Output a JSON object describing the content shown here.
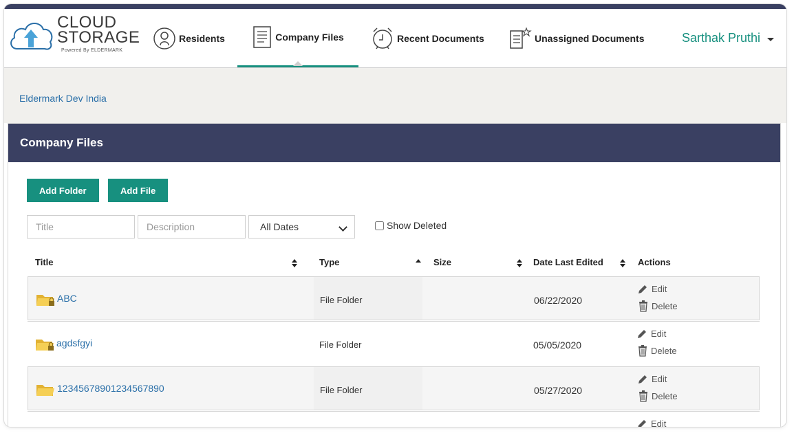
{
  "app": {
    "logo_line1": "CLOUD",
    "logo_line2": "STORAGE",
    "logo_powered": "Powered By ELDERMARK"
  },
  "nav": {
    "items": [
      {
        "label": "Residents",
        "icon": "person-circle-icon"
      },
      {
        "label": "Company Files",
        "icon": "document-lines-icon",
        "active": true
      },
      {
        "label": "Recent Documents",
        "icon": "alarm-clock-icon"
      },
      {
        "label": "Unassigned Documents",
        "icon": "document-star-icon"
      }
    ],
    "user_name": "Sarthak Pruthi"
  },
  "breadcrumb": "Eldermark Dev India",
  "panel": {
    "title": "Company Files",
    "add_folder_label": "Add Folder",
    "add_file_label": "Add File",
    "filters": {
      "title_placeholder": "Title",
      "description_placeholder": "Description",
      "date_value": "All Dates",
      "show_deleted_label": "Show Deleted"
    },
    "columns": {
      "title": "Title",
      "type": "Type",
      "size": "Size",
      "date": "Date Last Edited",
      "actions": "Actions"
    },
    "rows": [
      {
        "title": "ABC",
        "type": "File Folder",
        "size": "",
        "date": "06/22/2020",
        "locked": true
      },
      {
        "title": "agdsfgyi",
        "type": "File Folder",
        "size": "",
        "date": "05/05/2020",
        "locked": true
      },
      {
        "title": "12345678901234567890",
        "type": "File Folder",
        "size": "",
        "date": "05/27/2020",
        "locked": false
      },
      {
        "title": "",
        "type": "",
        "size": "",
        "date": "",
        "locked": false
      }
    ],
    "edit_label": "Edit",
    "delete_label": "Delete"
  },
  "colors": {
    "accent": "#17907f",
    "header_bar": "#3a4062",
    "link": "#2a6fa8"
  }
}
